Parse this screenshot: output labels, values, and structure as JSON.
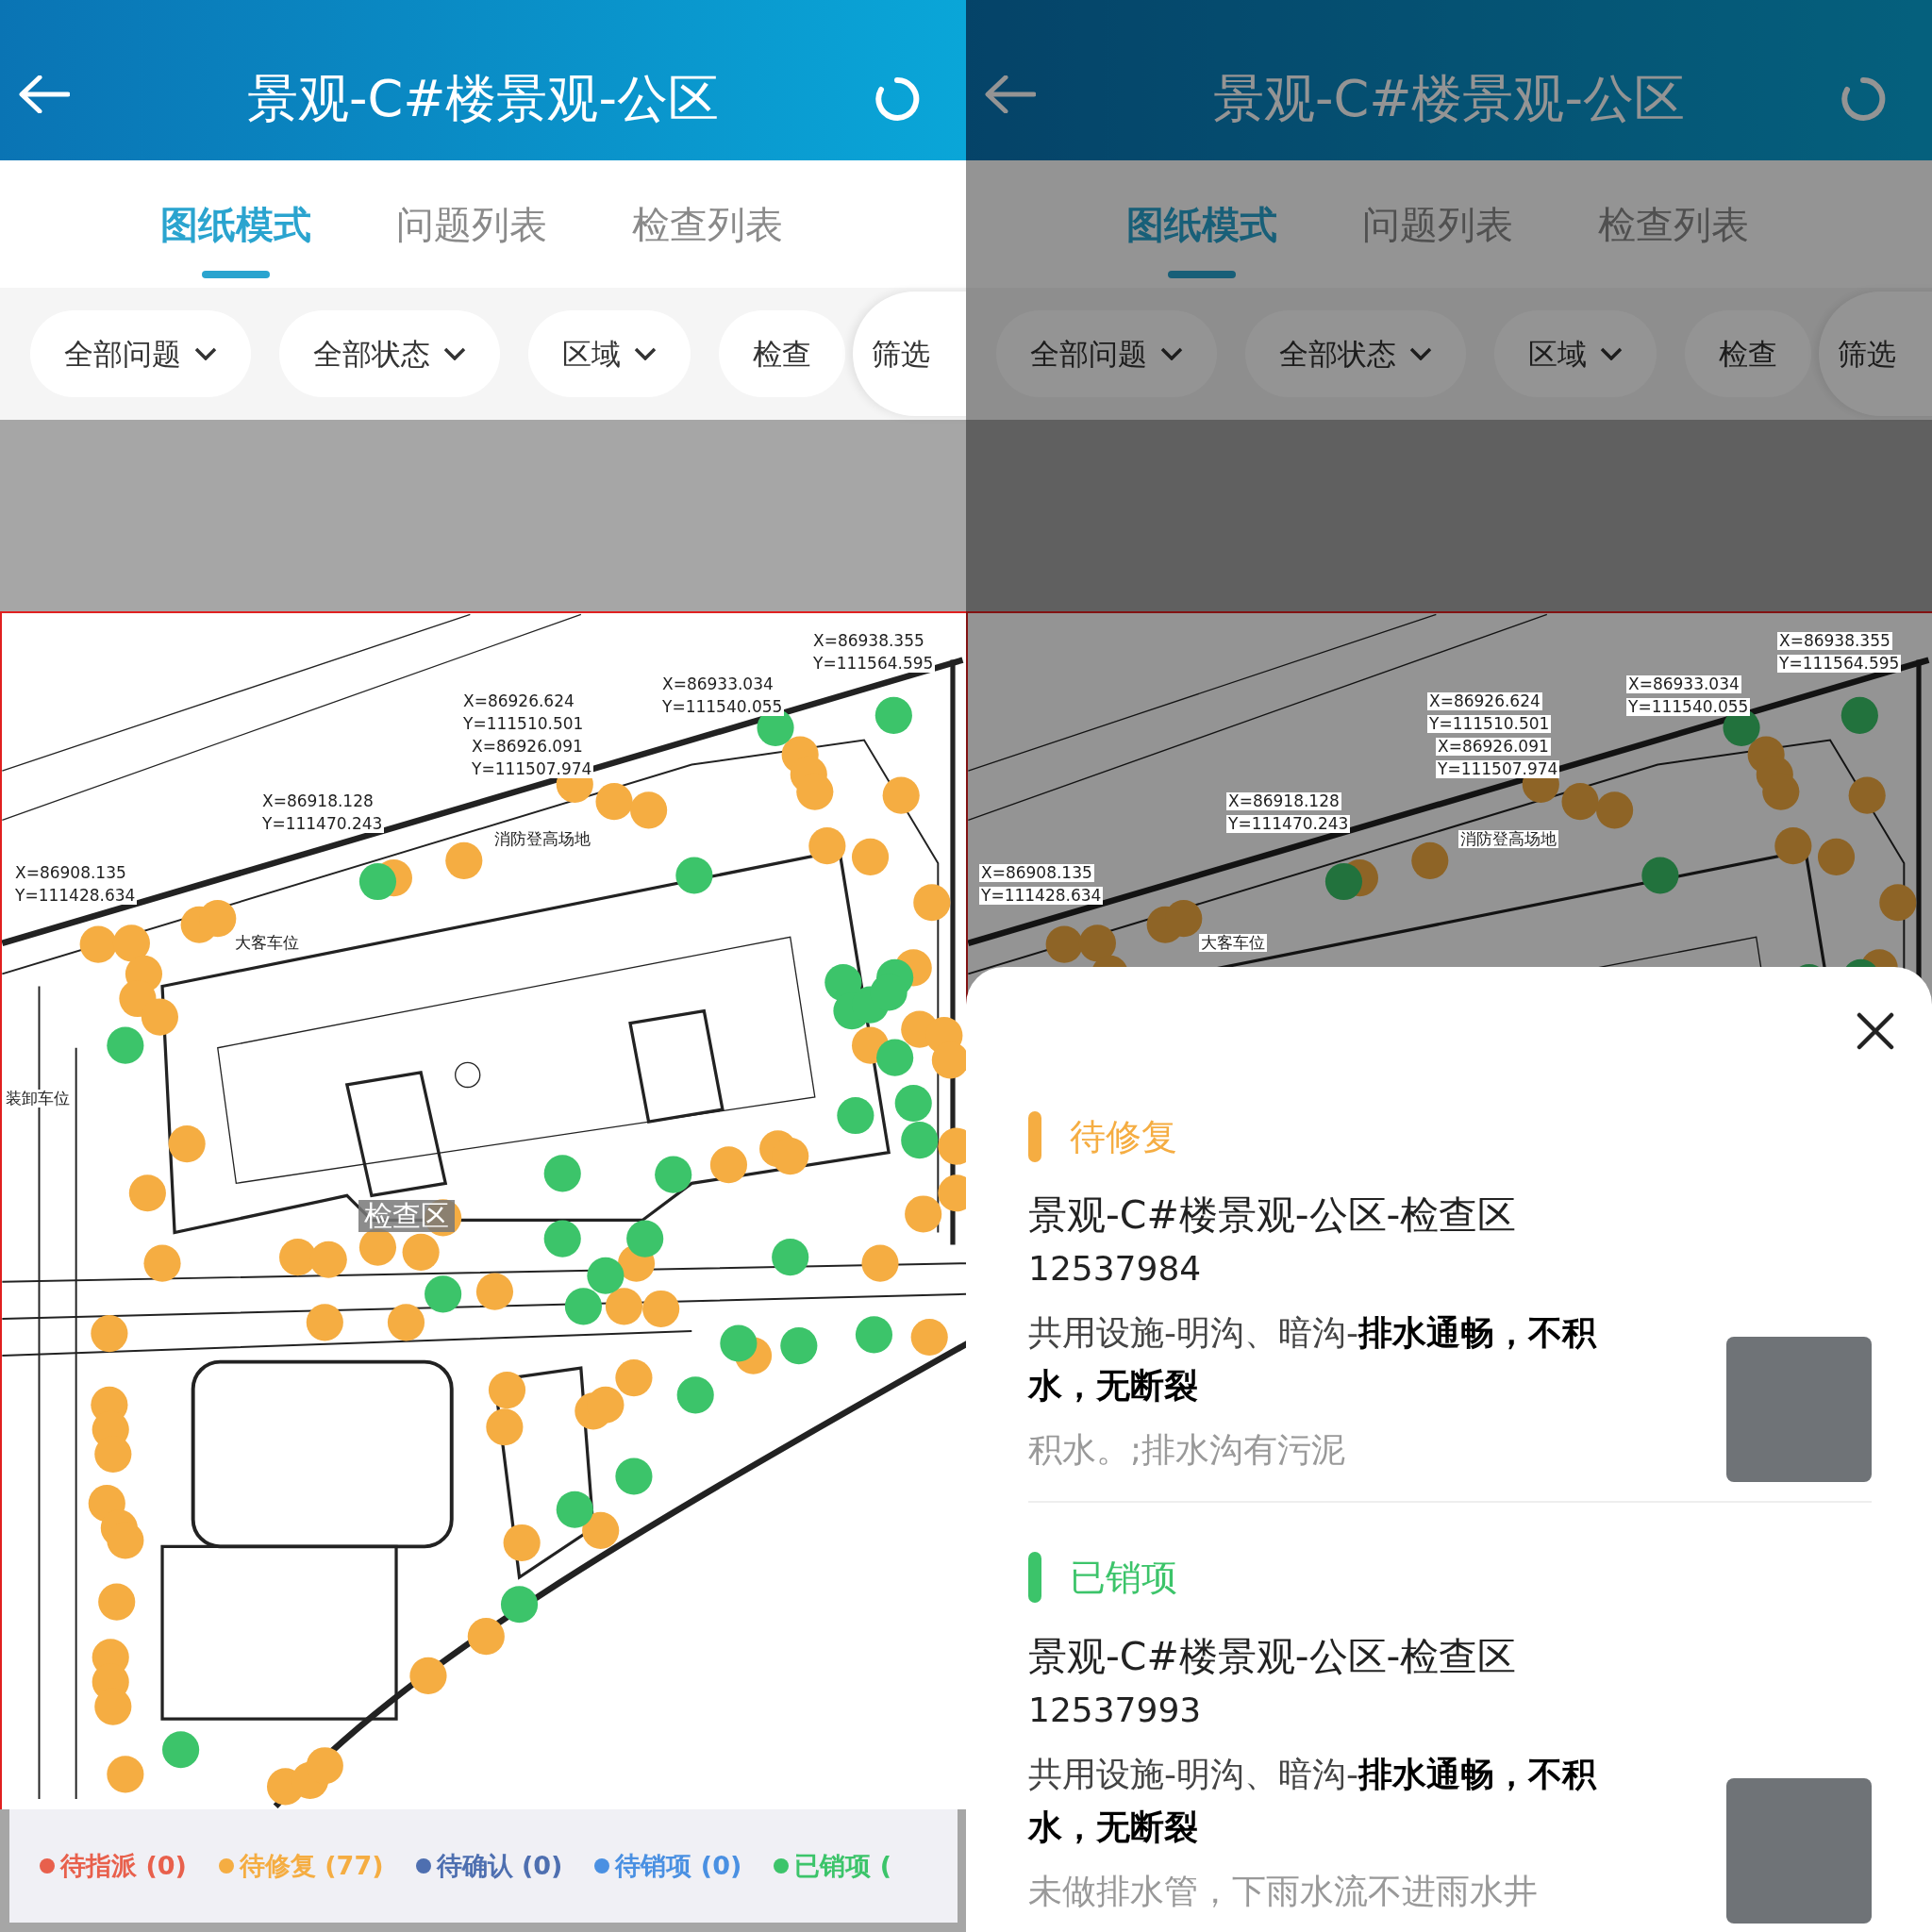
{
  "screens": [
    {
      "dimmed": false,
      "header": {
        "title": "景观-C#楼景观-公区"
      },
      "tabs": [
        {
          "label": "图纸模式",
          "selected": true
        },
        {
          "label": "问题列表",
          "selected": false
        },
        {
          "label": "检查列表",
          "selected": false
        }
      ],
      "filters": [
        {
          "label": "全部问题",
          "kind": "dropdown"
        },
        {
          "label": "全部状态",
          "kind": "dropdown"
        },
        {
          "label": "区域",
          "kind": "dropdown"
        },
        {
          "label": "检查",
          "kind": "plain"
        }
      ],
      "filter_button": "筛选",
      "plan": {
        "labels": [
          "X=86938.355",
          "Y=111564.595",
          "X=86933.034",
          "Y=111540.055",
          "X=86926.624",
          "Y=111510.501",
          "X=86926.091",
          "Y=111507.974",
          "X=86918.128",
          "Y=111470.243",
          "X=86908.135",
          "Y=111428.634",
          "消防登高场地",
          "大客车位",
          "装卸车位",
          "检查区"
        ]
      },
      "legend": [
        {
          "label": "待指派 (0)",
          "color": "#e8604c"
        },
        {
          "label": "待修复 (77)",
          "color": "#f5ad42"
        },
        {
          "label": "待确认 (0)",
          "color": "#4e6fb0"
        },
        {
          "label": "待销项 (0)",
          "color": "#4a90e2"
        },
        {
          "label": "已销项 (",
          "color": "#3cc46a"
        }
      ]
    },
    {
      "dimmed": true,
      "header": {
        "title": "景观-C#楼景观-公区"
      },
      "tabs": [
        {
          "label": "图纸模式",
          "selected": true
        },
        {
          "label": "问题列表",
          "selected": false
        },
        {
          "label": "检查列表",
          "selected": false
        }
      ],
      "filters": [
        {
          "label": "全部问题",
          "kind": "dropdown"
        },
        {
          "label": "全部状态",
          "kind": "dropdown"
        },
        {
          "label": "区域",
          "kind": "dropdown"
        },
        {
          "label": "检查",
          "kind": "plain"
        }
      ],
      "filter_button": "筛选",
      "plan": {
        "labels": [
          "X=86938.355",
          "Y=111564.595",
          "X=86933.034",
          "Y=111540.055",
          "X=86926.624",
          "Y=111510.501",
          "X=86926.091",
          "Y=111507.974",
          "X=86918.128",
          "Y=111470.243",
          "X=86908.135",
          "Y=111428.634",
          "消防登高场地",
          "大客车位"
        ]
      },
      "sheet": {
        "items": [
          {
            "status": "待修复",
            "color": "#f5ad42",
            "title": "景观-C#楼景观-公区-检查区",
            "number": "12537984",
            "description": "共用设施-明沟、暗沟-**排水通畅，不积水，无断裂**",
            "note": "积水。;排水沟有污泥"
          },
          {
            "status": "已销项",
            "color": "#3cc46a",
            "title": "景观-C#楼景观-公区-检查区",
            "number": "12537993",
            "description": "共用设施-明沟、暗沟-**排水通畅，不积水，无断裂**",
            "note": "未做排水管，下雨水流不进雨水井"
          }
        ]
      }
    }
  ]
}
